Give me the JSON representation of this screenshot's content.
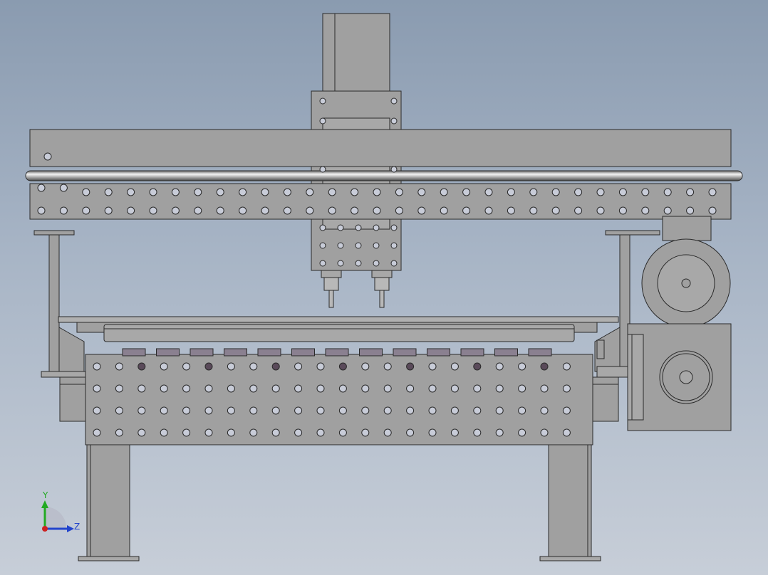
{
  "viewport": {
    "background_top": "#8a9bb0",
    "background_bottom": "#c7ced8"
  },
  "machine": {
    "part_fill": "#a0a0a0",
    "part_fill_light": "#b4b4b4",
    "edge_color": "#2a2a2a",
    "hole_fill": "#c8ccd8",
    "dark_hole_fill": "#5a4a5a"
  },
  "triad": {
    "y_label": "Y",
    "z_label": "Z",
    "y_color": "#22aa22",
    "z_color": "#2244cc",
    "x_color": "#cc2222"
  }
}
